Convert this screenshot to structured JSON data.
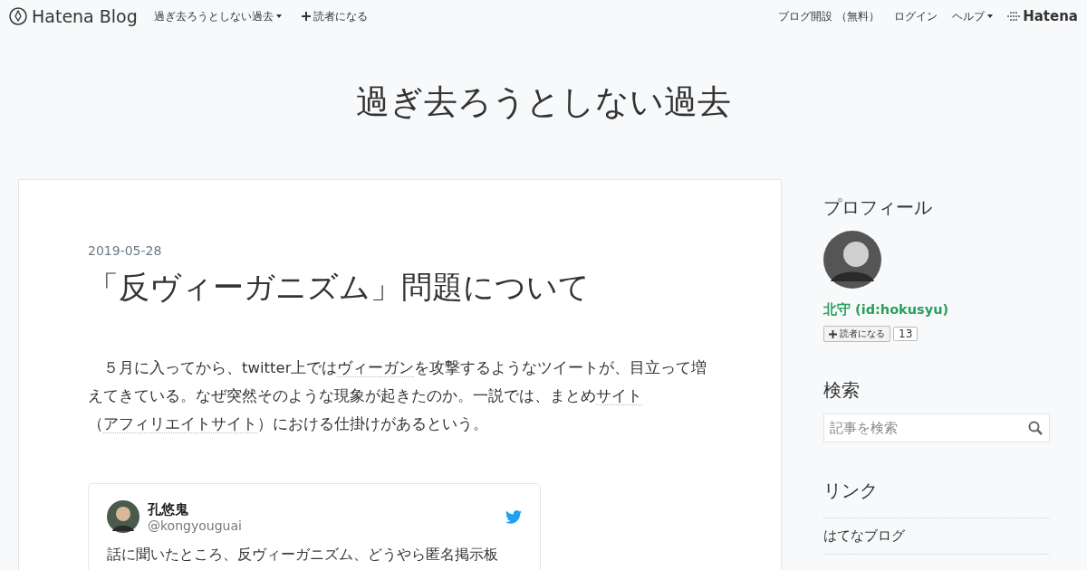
{
  "globalheader": {
    "logo": "Hatena Blog",
    "blog_menu": "過ぎ去ろうとしない過去",
    "subscribe": "読者になる",
    "right_links": [
      "ブログ開設 （無料）",
      "ログイン"
    ],
    "help": "ヘルプ",
    "brand": "Hatena"
  },
  "blog_title": "過ぎ去ろうとしない過去",
  "entry": {
    "date": "2019-05-28",
    "title": "「反ヴィーガニズム」問題について",
    "paragraph": [
      {
        "kind": "text",
        "text": "　５月に入ってから、twitter上では"
      },
      {
        "kind": "keyword",
        "text": "ヴィーガン"
      },
      {
        "kind": "text",
        "text": "を攻撃するようなツイートが、目立って増えてきている。なぜ突然そのような現象が起きたのか。一説では、まとめ"
      },
      {
        "kind": "keyword",
        "text": "サイト"
      },
      {
        "kind": "text",
        "text": "（"
      },
      {
        "kind": "keyword",
        "text": "アフィリエイトサイト"
      },
      {
        "kind": "text",
        "text": "）における仕掛けがあるという。"
      }
    ],
    "tweet": {
      "name": "孔悠鬼",
      "handle": "@kongyouguai",
      "text": "話に聞いたところ、反ヴィーガニズム、どうやら匿名掲示板"
    }
  },
  "sidebar": {
    "profile": {
      "heading": "プロフィール",
      "name": "北守 (id:hokusyu)",
      "subscribe": "読者になる",
      "count": "13"
    },
    "search": {
      "heading": "検索",
      "placeholder": "記事を検索"
    },
    "links": {
      "heading": "リンク",
      "items": [
        "はてなブログ"
      ]
    }
  }
}
